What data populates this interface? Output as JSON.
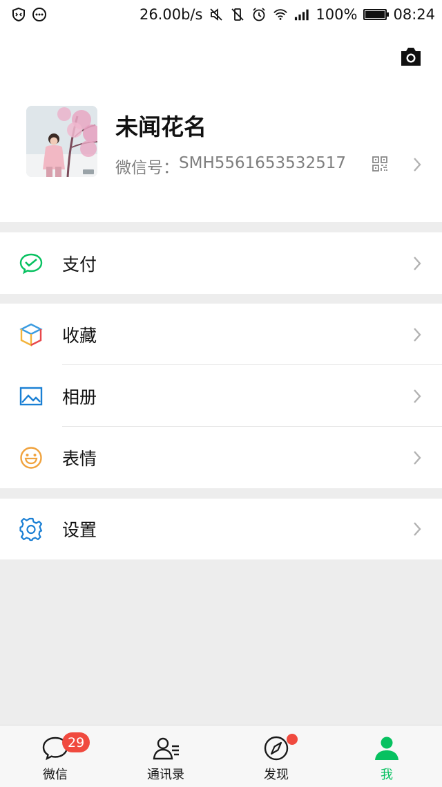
{
  "status_bar": {
    "net_speed": "26.00b/s",
    "battery": "100%",
    "battery_level": 1.0,
    "time": "08:24"
  },
  "profile": {
    "nickname": "未闻花名",
    "wechat_id_label": "微信号：",
    "wechat_id": "SMH5561653532517"
  },
  "menu": {
    "pay": "支付",
    "favorites": "收藏",
    "album": "相册",
    "stickers": "表情",
    "settings": "设置"
  },
  "tabs": [
    {
      "label": "微信",
      "badge": "29"
    },
    {
      "label": "通讯录"
    },
    {
      "label": "发现"
    },
    {
      "label": "我"
    }
  ],
  "colors": {
    "accent_green": "#07c160",
    "badge_red": "#f04a3f",
    "album_blue": "#1a7fd4",
    "settings_blue": "#1a7fd4",
    "stickers_orange": "#f0a33e"
  }
}
